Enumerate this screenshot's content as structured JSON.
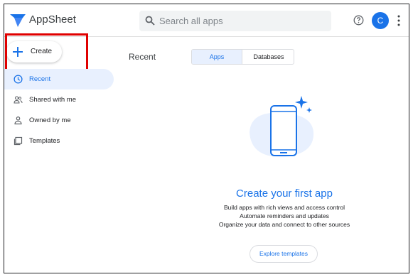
{
  "header": {
    "app_name": "AppSheet",
    "search_placeholder": "Search all apps",
    "avatar_initial": "C"
  },
  "sidebar": {
    "create_label": "Create",
    "items": [
      {
        "label": "Recent",
        "icon": "clock-icon",
        "active": true
      },
      {
        "label": "Shared with me",
        "icon": "people-icon",
        "active": false
      },
      {
        "label": "Owned by me",
        "icon": "person-icon",
        "active": false
      },
      {
        "label": "Templates",
        "icon": "templates-icon",
        "active": false
      }
    ]
  },
  "main": {
    "section_title": "Recent",
    "tabs": [
      {
        "label": "Apps",
        "selected": true
      },
      {
        "label": "Databases",
        "selected": false
      }
    ],
    "empty_state": {
      "title": "Create your first app",
      "lines": [
        "Build apps with rich views and access control",
        "Automate reminders and updates",
        "Organize your data and connect to other sources"
      ],
      "button_label": "Explore templates"
    }
  },
  "colors": {
    "accent": "#1a73e8",
    "active_bg": "#e8f0fe",
    "highlight": "#e00000"
  }
}
